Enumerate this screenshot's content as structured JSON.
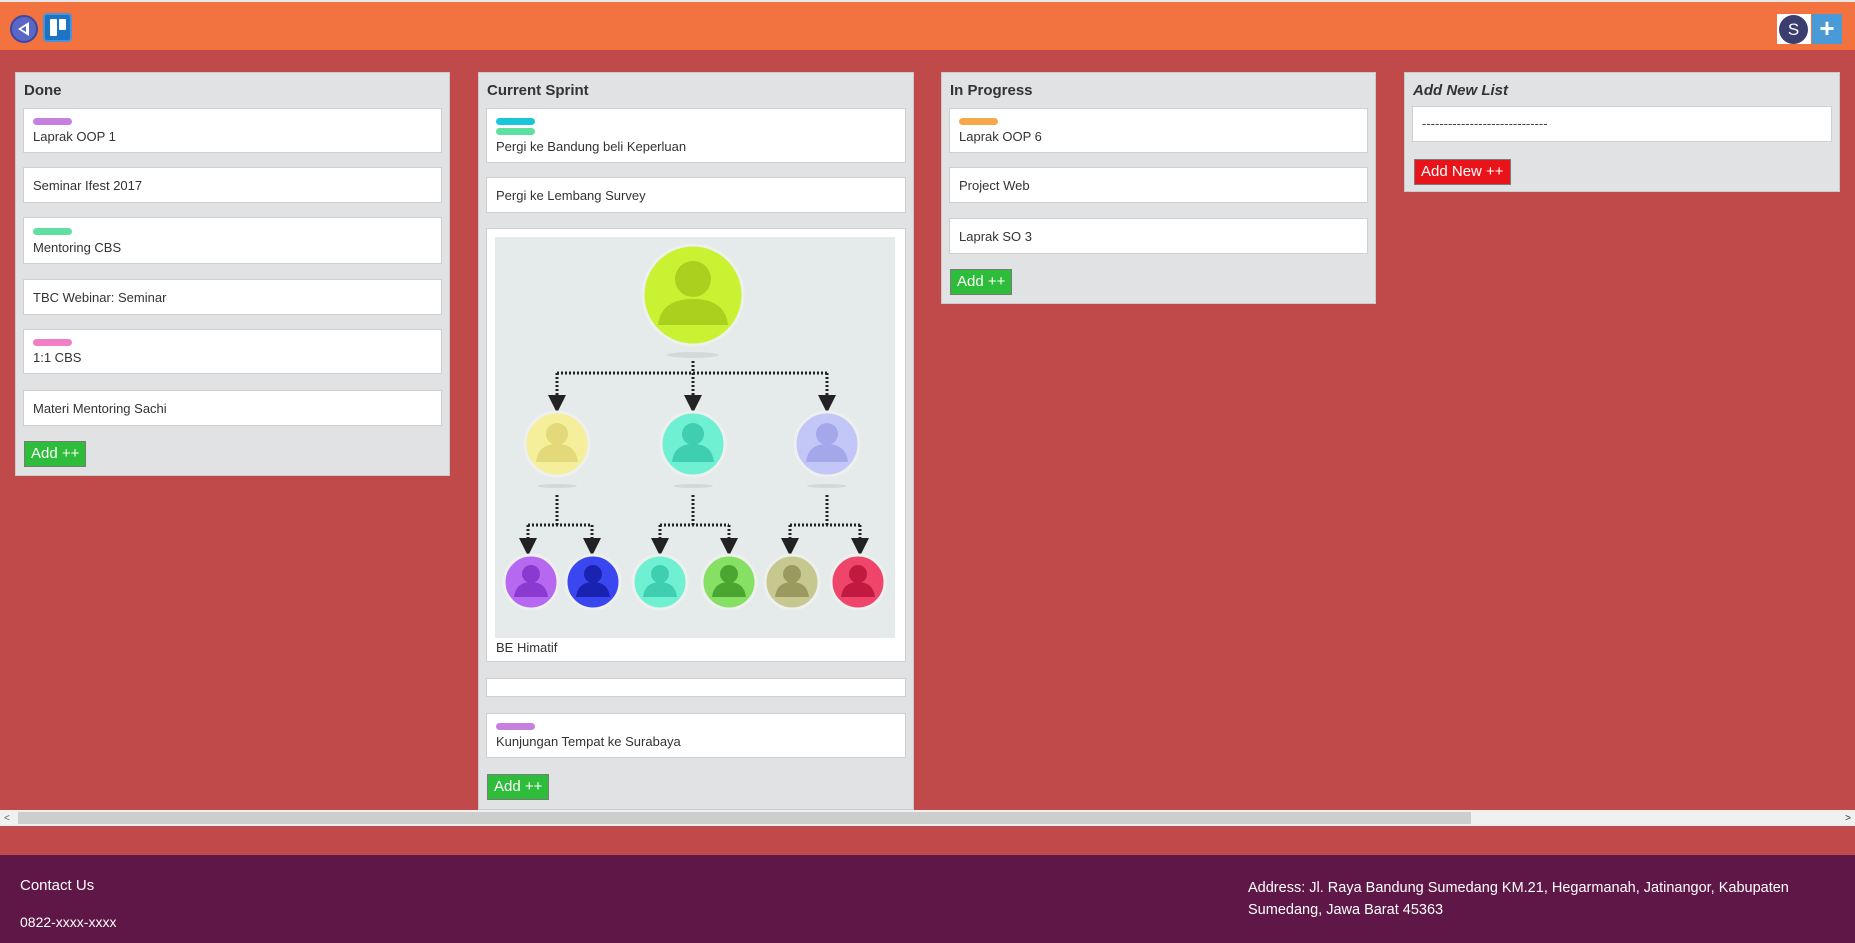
{
  "header": {
    "back_icon": "back-arrow-icon",
    "logo_icon": "board-logo-icon",
    "avatar_initial": "S",
    "add_icon_label": "+"
  },
  "lists": {
    "done": {
      "title": "Done",
      "cards": [
        {
          "text": "Laprak OOP 1",
          "label_color": "#c77fe0"
        },
        {
          "text": "Seminar Ifest 2017"
        },
        {
          "text": "Mentoring CBS",
          "label_color": "#5fe0a0"
        },
        {
          "text": "TBC Webinar: Seminar"
        },
        {
          "text": "1:1 CBS",
          "label_color": "#f07fc6"
        },
        {
          "text": "Materi Mentoring Sachi"
        }
      ],
      "add_label": "Add ++"
    },
    "current_sprint": {
      "title": "Current Sprint",
      "cards": [
        {
          "text": "Pergi ke Bandung beli Keperluan",
          "label_colors": [
            "#19c6d8",
            "#5fe0a0"
          ]
        },
        {
          "text": "Pergi ke Lembang Survey"
        },
        {
          "text": "BE Himatif",
          "image": "org-chart-image"
        },
        {
          "text": ""
        },
        {
          "text": "Kunjungan Tempat ke Surabaya",
          "label_color": "#c77fe0"
        }
      ],
      "add_label": "Add ++"
    },
    "in_progress": {
      "title": "In Progress",
      "cards": [
        {
          "text": "Laprak OOP 6",
          "label_color": "#f5a84a"
        },
        {
          "text": "Project Web"
        },
        {
          "text": "Laprak SO 3"
        }
      ],
      "add_label": "Add ++"
    },
    "add_new_list": {
      "title": "Add New List",
      "input_value": "-----------------------------",
      "button_label": "Add New ++"
    }
  },
  "scrollbar": {
    "left_arrow": "<",
    "right_arrow": ">"
  },
  "footer": {
    "contact_title": "Contact Us",
    "phone": "0822-xxxx-xxxx",
    "address": "Address: Jl. Raya Bandung Sumedang KM.21, Hegarmanah, Jatinangor, Kabupaten Sumedang, Jawa Barat 45363"
  },
  "colors": {
    "topbar": "#f2733f",
    "background": "#c0494a",
    "footer": "#5e1746",
    "add_button": "#2ebd3a",
    "add_new_button": "#e8141a"
  }
}
